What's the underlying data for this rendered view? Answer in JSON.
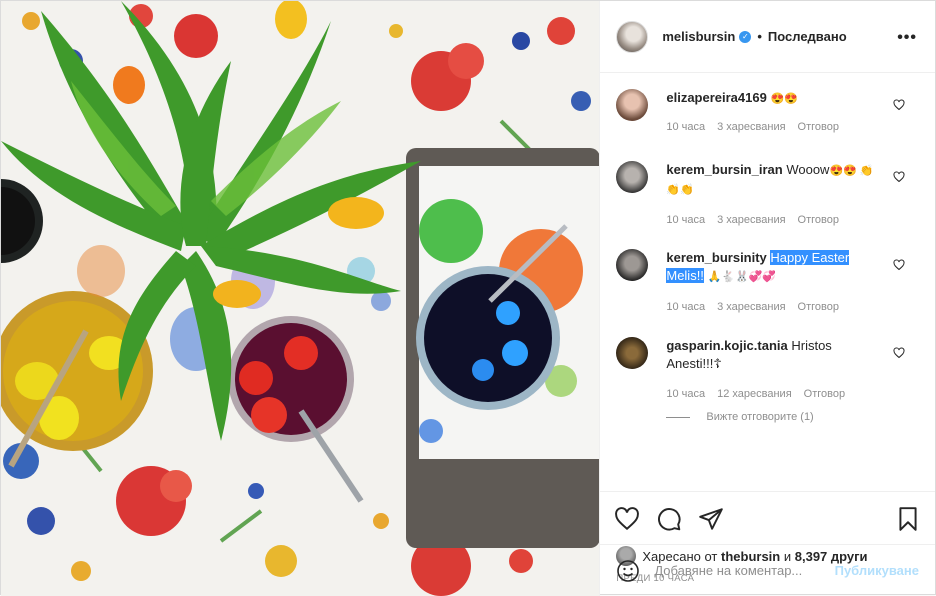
{
  "header": {
    "username": "melisbursin",
    "verified_mark": "✓",
    "separator": "•",
    "follow_status": "Последвано",
    "more_label": "•••"
  },
  "comments": [
    {
      "username": "elizapereira4169",
      "text": "",
      "emoji": "😍😍",
      "time": "10 часа",
      "likes": "3 харесвания",
      "reply": "Отговор"
    },
    {
      "username": "kerem_bursin_iran",
      "text": "Wooow",
      "emoji": "😍😍 👏👏👏",
      "time": "10 часа",
      "likes": "3 харесвания",
      "reply": "Отговор"
    },
    {
      "username": "kerem_bursinity",
      "text": "Happy Easter Melis!!",
      "emoji": "🙏🐇🐰💞💞",
      "time": "10 часа",
      "likes": "3 харесвания",
      "reply": "Отговор"
    },
    {
      "username": "gasparin.kojic.tania",
      "text": "Hristos Anesti!!!☦",
      "emoji": "",
      "time": "10 часа",
      "likes": "12 харесвания",
      "reply": "Отговор"
    }
  ],
  "view_replies": "Вижте отговорите (1)",
  "liked_by": {
    "prefix": "Харесано от",
    "user": "thebursin",
    "middle": "и",
    "others": "8,397 други"
  },
  "timestamp": "ПРЕДИ 10 ЧАСА",
  "add_comment": {
    "placeholder": "Добавяне на коментар...",
    "post_label": "Публикуване"
  },
  "icons": {
    "like": "heart-icon",
    "comment": "comment-icon",
    "share": "share-icon",
    "save": "bookmark-icon",
    "emoji": "smiley-icon",
    "more": "more-icon"
  },
  "colors": {
    "accent": "#3897f0",
    "muted": "#8e8e8e",
    "post_disabled": "#b2dffc",
    "highlight": "#3390ff"
  }
}
